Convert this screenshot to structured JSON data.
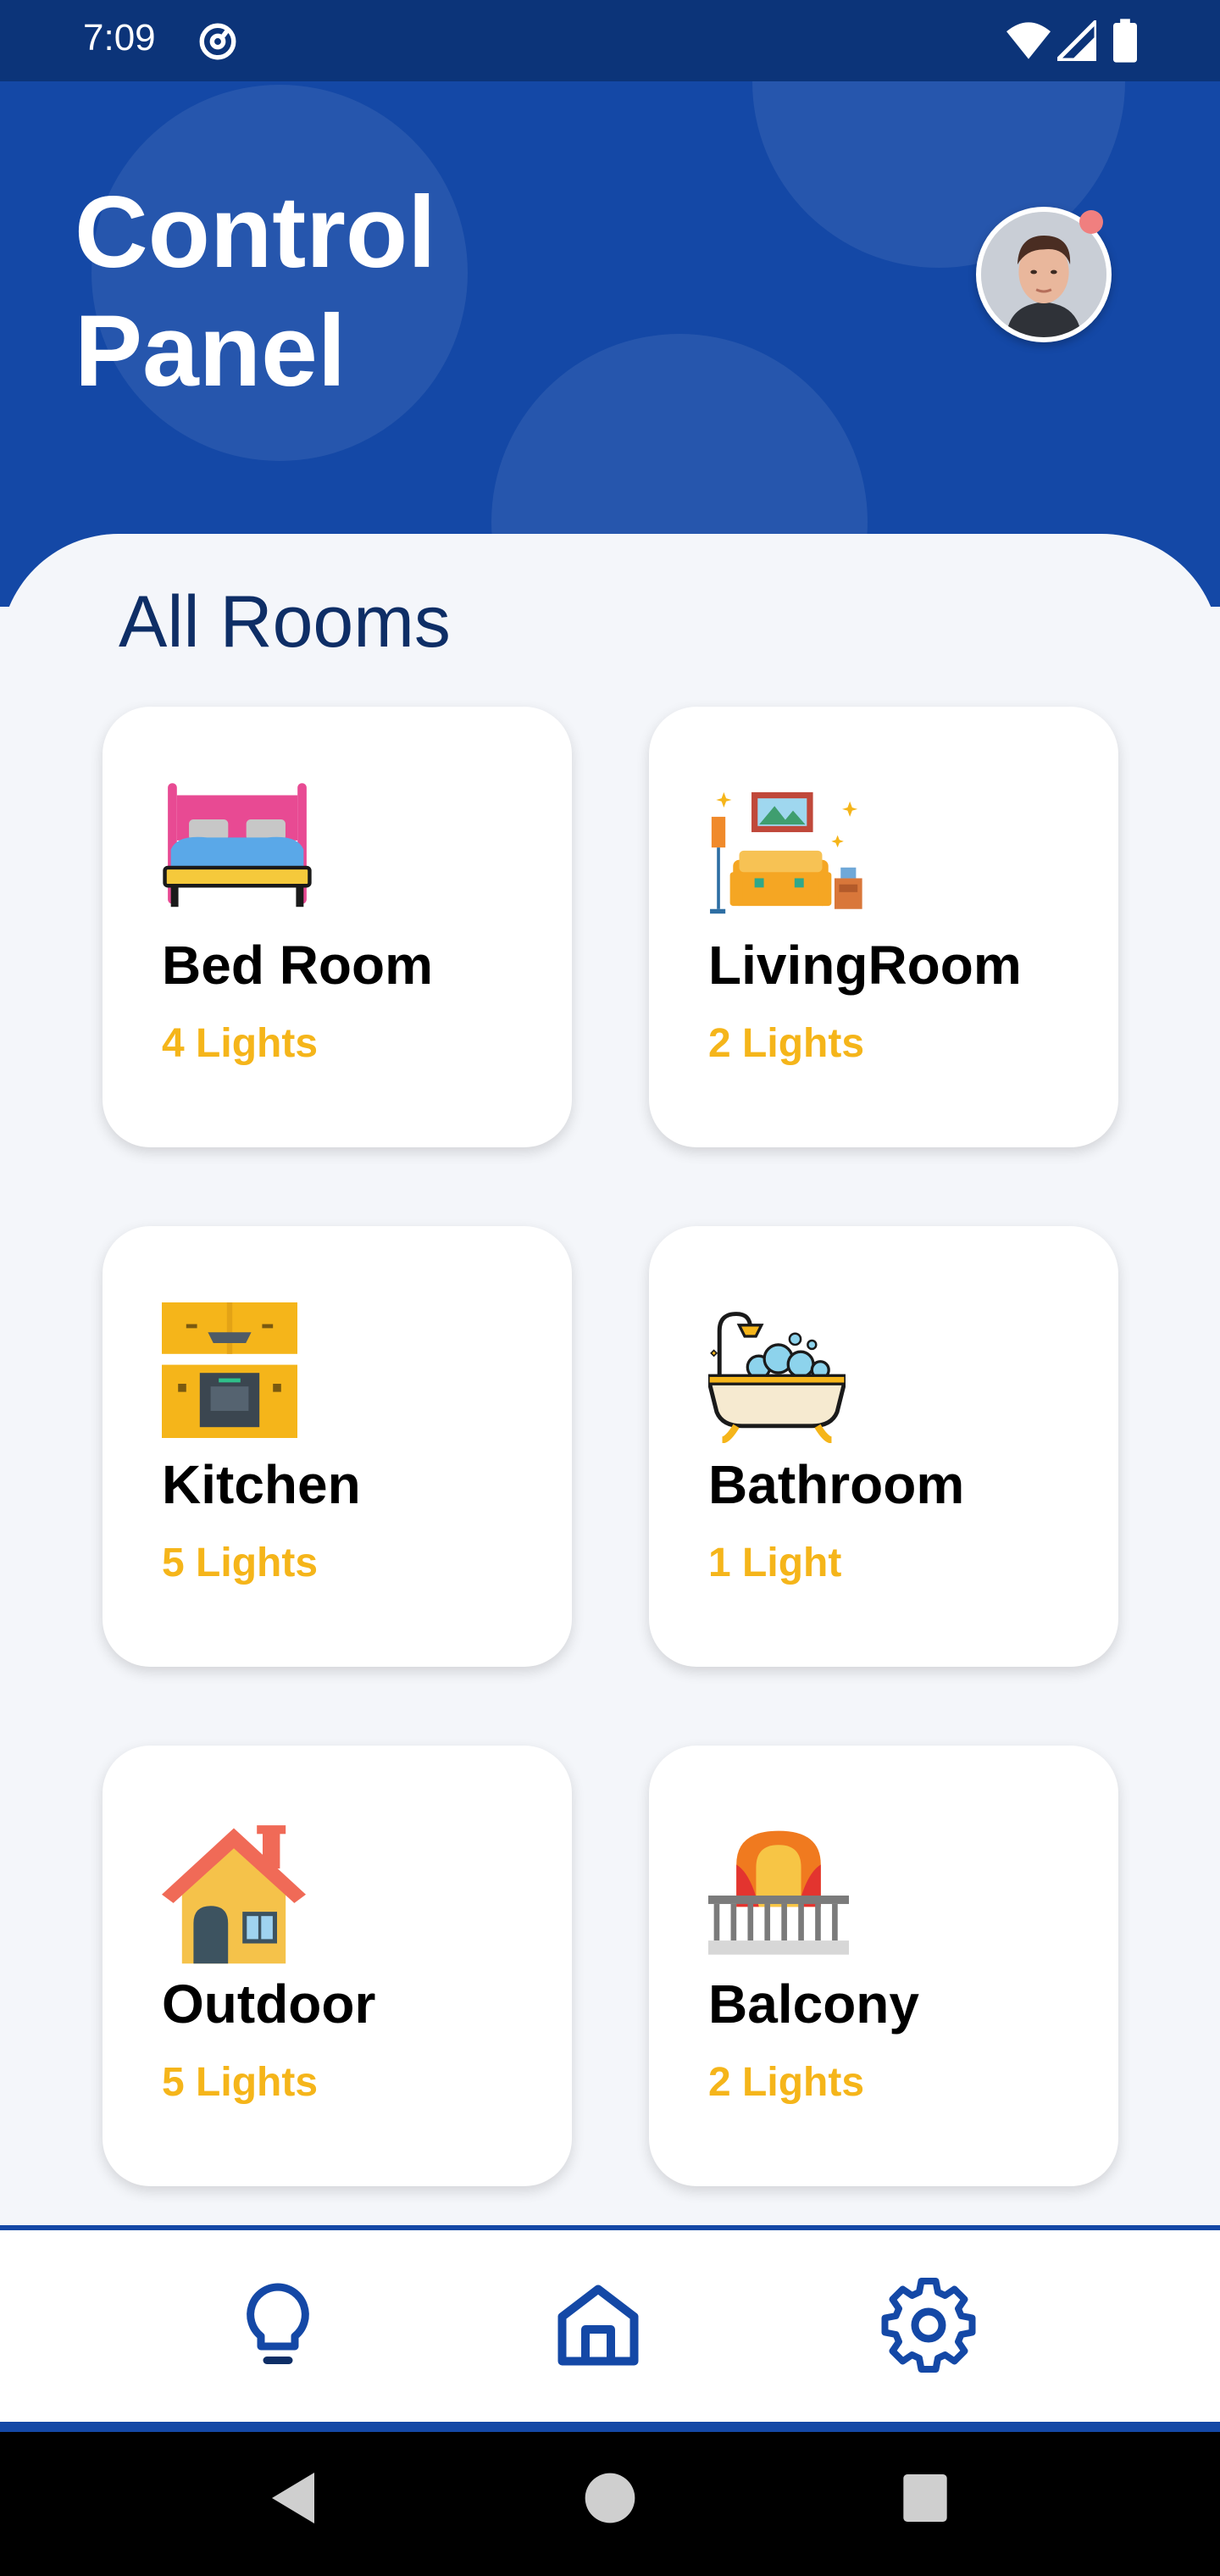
{
  "status_bar": {
    "time": "7:09"
  },
  "header": {
    "title_line1": "Control",
    "title_line2": "Panel"
  },
  "section": {
    "title": "All Rooms"
  },
  "rooms": [
    {
      "name": "Bed Room",
      "lights": "4 Lights",
      "icon": "bed-icon"
    },
    {
      "name": "LivingRoom",
      "lights": "2 Lights",
      "icon": "living-room-icon"
    },
    {
      "name": "Kitchen",
      "lights": "5 Lights",
      "icon": "kitchen-icon"
    },
    {
      "name": "Bathroom",
      "lights": "1 Light",
      "icon": "bathtub-icon"
    },
    {
      "name": "Outdoor",
      "lights": "5 Lights",
      "icon": "house-icon"
    },
    {
      "name": "Balcony",
      "lights": "2 Lights",
      "icon": "balcony-icon"
    }
  ],
  "bottom_nav": {
    "items": [
      {
        "icon": "lightbulb-icon"
      },
      {
        "icon": "home-icon",
        "active": true
      },
      {
        "icon": "settings-gear-icon"
      }
    ]
  },
  "colors": {
    "header_blue": "#1448a6",
    "status_bar": "#0c3479",
    "accent_yellow": "#f5b51a",
    "title_navy": "#0e2e66"
  }
}
